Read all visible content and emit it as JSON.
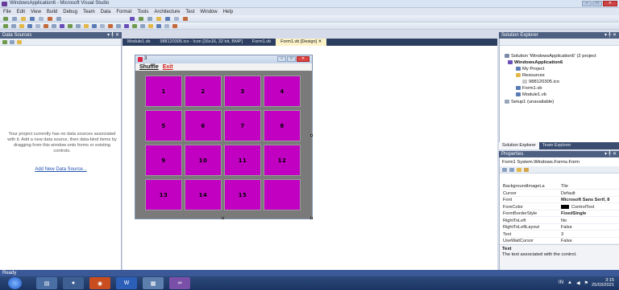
{
  "app": {
    "title": "WindowsApplication6 - Microsoft Visual Studio",
    "window_buttons": {
      "minimize": "–",
      "maximize": "□",
      "close": "✕"
    }
  },
  "menubar": [
    "File",
    "Edit",
    "View",
    "Build",
    "Debug",
    "Team",
    "Data",
    "Format",
    "Tools",
    "Architecture",
    "Test",
    "Window",
    "Help"
  ],
  "data_sources": {
    "header": "Data Sources",
    "pin": "▾ ╀ ✕",
    "message": "Your project currently has no data sources associated with it. Add a new data source, then data-bind items by dragging from this window onto forms or existing controls.",
    "link": "Add New Data Source..."
  },
  "tabs": [
    {
      "label": "Module1.vb",
      "active": false
    },
    {
      "label": "988120305.ico - Icon [16x16, 32 bit, BMP]",
      "active": false
    },
    {
      "label": "Form1.vb",
      "active": false
    },
    {
      "label": "Form1.vb [Design]  ✕",
      "active": true
    }
  ],
  "form": {
    "title": "3",
    "menu_shuffle": "Shuffle",
    "menu_exit": "Exit",
    "tiles": [
      "1",
      "2",
      "3",
      "4",
      "5",
      "6",
      "7",
      "8",
      "9",
      "10",
      "11",
      "12",
      "13",
      "14",
      "15",
      ""
    ]
  },
  "solution_explorer": {
    "header": "Solution Explorer",
    "pin": "▾ ╀ ✕",
    "nodes": [
      {
        "label": "Solution 'WindowsApplication6' (2 project",
        "bold": false,
        "color": "#7a8aa8"
      },
      {
        "label": "WindowsApplication6",
        "bold": true,
        "color": "#6a4fb8"
      },
      {
        "label": "My Project",
        "bold": false,
        "color": "#5b7bb5"
      },
      {
        "label": "Resources",
        "bold": false,
        "color": "#e2b84a"
      },
      {
        "label": "988120305.ico",
        "bold": false,
        "color": "#c7c7c7"
      },
      {
        "label": "Form1.vb",
        "bold": false,
        "color": "#5b7bb5"
      },
      {
        "label": "Module1.vb",
        "bold": false,
        "color": "#5b7bb5"
      },
      {
        "label": "Setup1 (unavailable)",
        "bold": false,
        "color": "#9aa7bb"
      }
    ],
    "tab_solution": "Solution Explorer",
    "tab_team": "Team Explorer"
  },
  "properties": {
    "header": "Properties",
    "pin": "▾ ╀ ✕",
    "object": "Form1  System.Windows.Forms.Form",
    "rows": [
      {
        "key": "BackgroundImageLa",
        "value": "Tile",
        "bold": false,
        "swatch": false
      },
      {
        "key": "Cursor",
        "value": "Default",
        "bold": false,
        "swatch": false
      },
      {
        "key": "Font",
        "value": "Microsoft Sans Serif, 8",
        "bold": true,
        "swatch": false
      },
      {
        "key": "ForeColor",
        "value": "ControlText",
        "bold": false,
        "swatch": true
      },
      {
        "key": "FormBorderStyle",
        "value": "FixedSingle",
        "bold": true,
        "swatch": false
      },
      {
        "key": "RightToLeft",
        "value": "No",
        "bold": false,
        "swatch": false
      },
      {
        "key": "RightToLeftLayout",
        "value": "False",
        "bold": false,
        "swatch": false
      },
      {
        "key": "Text",
        "value": "3",
        "bold": false,
        "swatch": false
      },
      {
        "key": "UseWaitCursor",
        "value": "False",
        "bold": false,
        "swatch": false
      }
    ],
    "desc_title": "Text",
    "desc_text": "The text associated with the control."
  },
  "status": {
    "text": "Ready"
  },
  "taskbar": {
    "lang": "IN",
    "time": "3:15",
    "date": "25/03/2021"
  },
  "colors": {
    "tile": "#c200c2",
    "form_body": "#7a7a7a",
    "accent": "#3b5998"
  }
}
